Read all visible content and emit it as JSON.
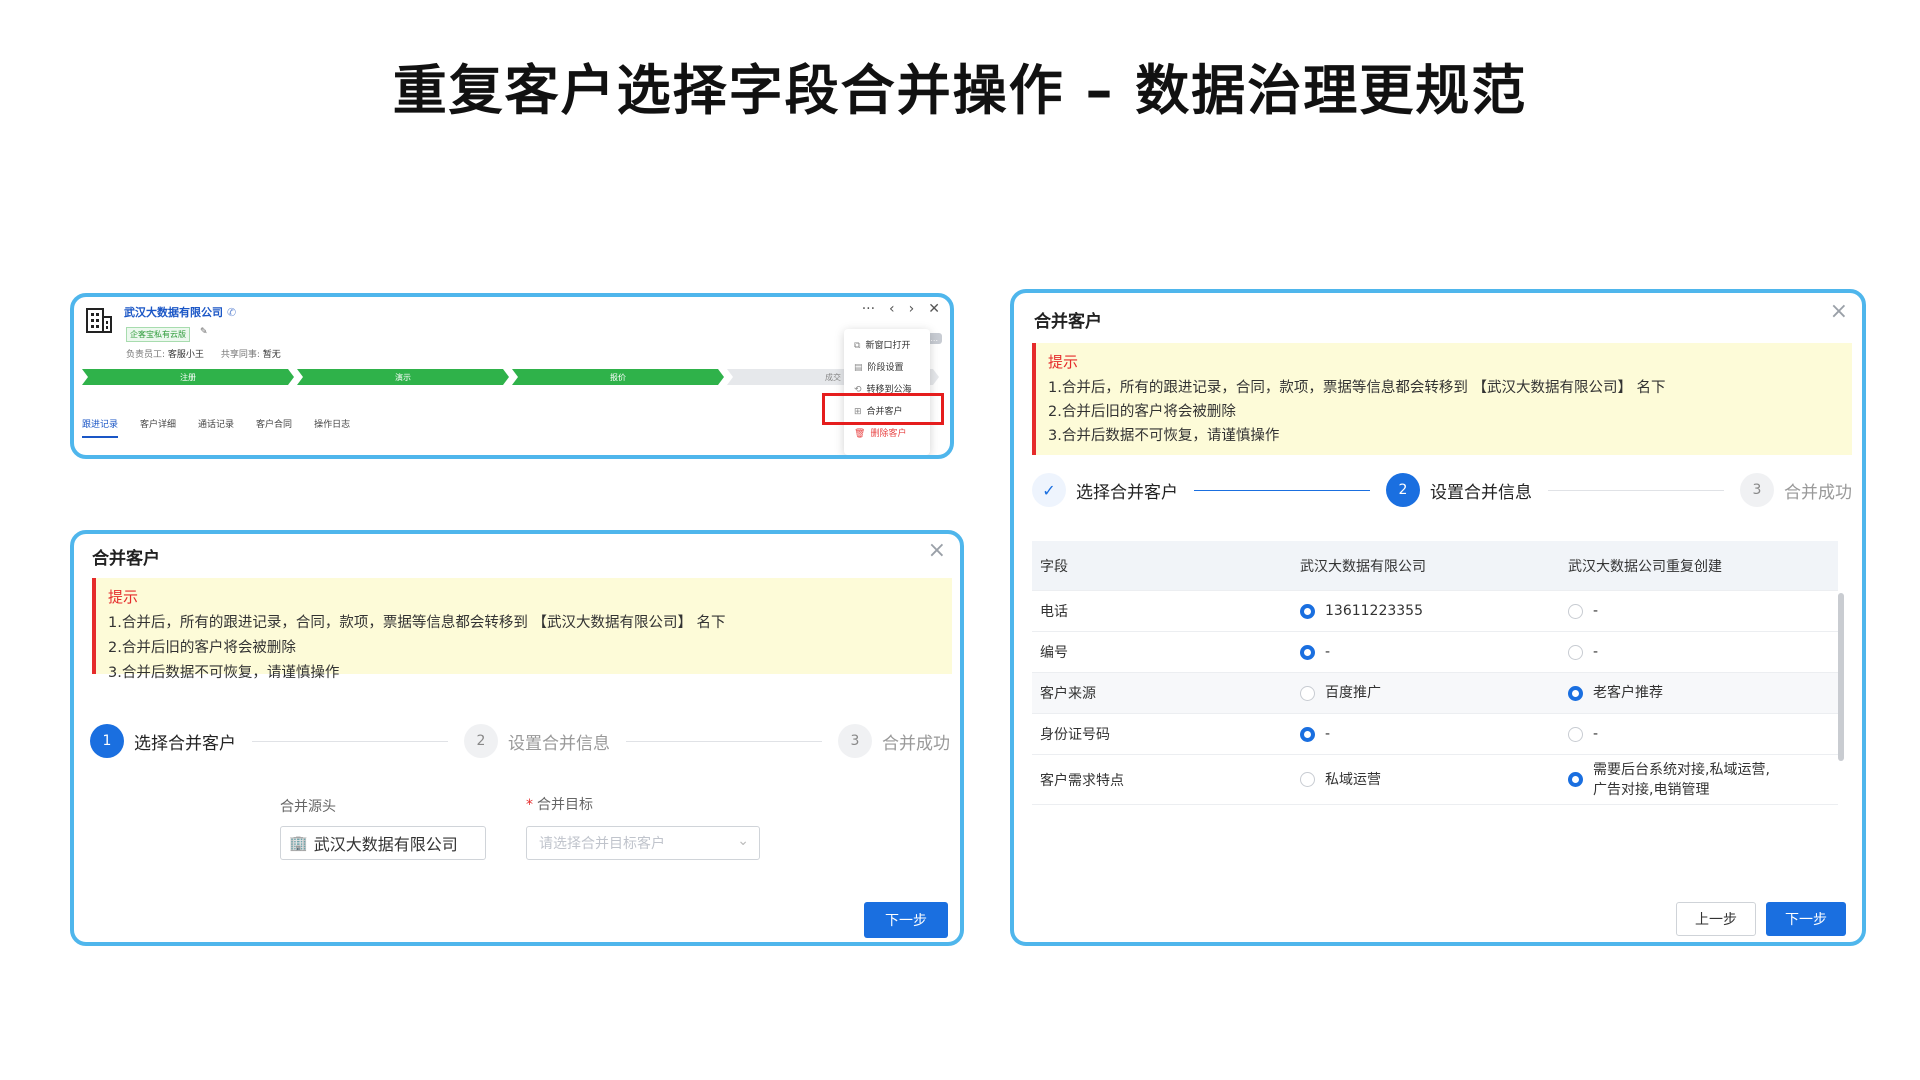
{
  "title": "重复客户选择字段合并操作 – 数据治理更规范",
  "panel1": {
    "customer_name": "武汉大数据有限公司",
    "phone_icon": "phone-icon",
    "tag": "企客宝私有云版",
    "owner_label": "负责员工:",
    "owner_value": "客服小王",
    "shared_label": "共享同事:",
    "shared_value": "暂无",
    "stages": [
      {
        "label": "注册",
        "done": true
      },
      {
        "label": "演示",
        "done": true
      },
      {
        "label": "报价",
        "done": true
      },
      {
        "label": "成交",
        "done": false
      }
    ],
    "tabs": [
      "跟进记录",
      "客户详细",
      "通话记录",
      "客户合同",
      "操作日志"
    ],
    "ctrl_more": "···",
    "ctrl_prev": "‹",
    "ctrl_next": "›",
    "ctrl_close": "✕",
    "menu": [
      {
        "label": "新窗口打开",
        "icon": "⧉"
      },
      {
        "label": "阶段设置",
        "icon": "▤"
      },
      {
        "label": "转移到公海",
        "icon": "⟲"
      },
      {
        "label": "合并客户",
        "icon": "⊞"
      },
      {
        "label": "删除客户",
        "icon": "🗑"
      }
    ]
  },
  "dialog_title": "合并客户",
  "warning": {
    "title": "提示",
    "lines": [
      "1.合并后，所有的跟进记录，合同，款项，票据等信息都会转移到 【武汉大数据有限公司】 名下",
      "2.合并后旧的客户将会被删除",
      "3.合并后数据不可恢复，请谨慎操作"
    ]
  },
  "steps": [
    {
      "num": "1",
      "label": "选择合并客户"
    },
    {
      "num": "2",
      "label": "设置合并信息"
    },
    {
      "num": "3",
      "label": "合并成功"
    }
  ],
  "step_done_mark": "✓",
  "panel2": {
    "source_label": "合并源头",
    "source_value": "武汉大数据有限公司",
    "target_required": "*",
    "target_label": "合并目标",
    "target_placeholder": "请选择合并目标客户",
    "next_button": "下一步"
  },
  "panel3": {
    "columns": [
      "字段",
      "武汉大数据有限公司",
      "武汉大数据公司重复创建"
    ],
    "rows": [
      {
        "field": "电话",
        "a": "13611223355",
        "b": "-",
        "selected": "a"
      },
      {
        "field": "编号",
        "a": "-",
        "b": "-",
        "selected": "a"
      },
      {
        "field": "客户来源",
        "a": "百度推广",
        "b": "老客户推荐",
        "selected": "b"
      },
      {
        "field": "身份证号码",
        "a": "-",
        "b": "-",
        "selected": "a"
      },
      {
        "field": "客户需求特点",
        "a": "私域运营",
        "b": "需要后台系统对接,私域运营,广告对接,电销管理",
        "selected": "b"
      }
    ],
    "prev_button": "上一步",
    "next_button": "下一步"
  },
  "colors": {
    "accent": "#1a6fe0",
    "frame": "#4fb6ec",
    "stage": "#2fb24a",
    "danger": "#e52b2b"
  }
}
